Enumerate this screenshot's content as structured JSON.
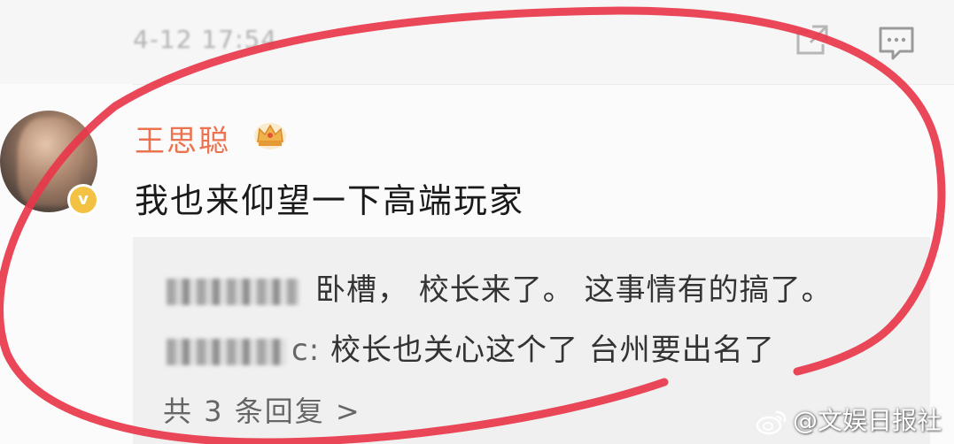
{
  "header": {
    "timestamp": "4-12 17:54",
    "icons": [
      "share-icon",
      "comment-icon"
    ]
  },
  "comment": {
    "username": "王思聪",
    "username_color": "#eb7350",
    "badge_icon": "crown-icon",
    "verified_icon": "verified-v-badge",
    "verified_letter": "v",
    "text": "我也来仰望一下高端玩家"
  },
  "replies": {
    "items": [
      {
        "name_blurred": true,
        "separator": "",
        "text": "卧槽， 校长来了。 这事情有的搞了。"
      },
      {
        "name_blurred": true,
        "separator": "c:",
        "text": "校长也关心这个了 台州要出名了"
      }
    ],
    "more_label": "共 3 条回复 >"
  },
  "annotation": {
    "circle_color": "#e8374a"
  },
  "watermark": {
    "text": "@文娱日报社",
    "icon": "weibo-logo-icon"
  }
}
